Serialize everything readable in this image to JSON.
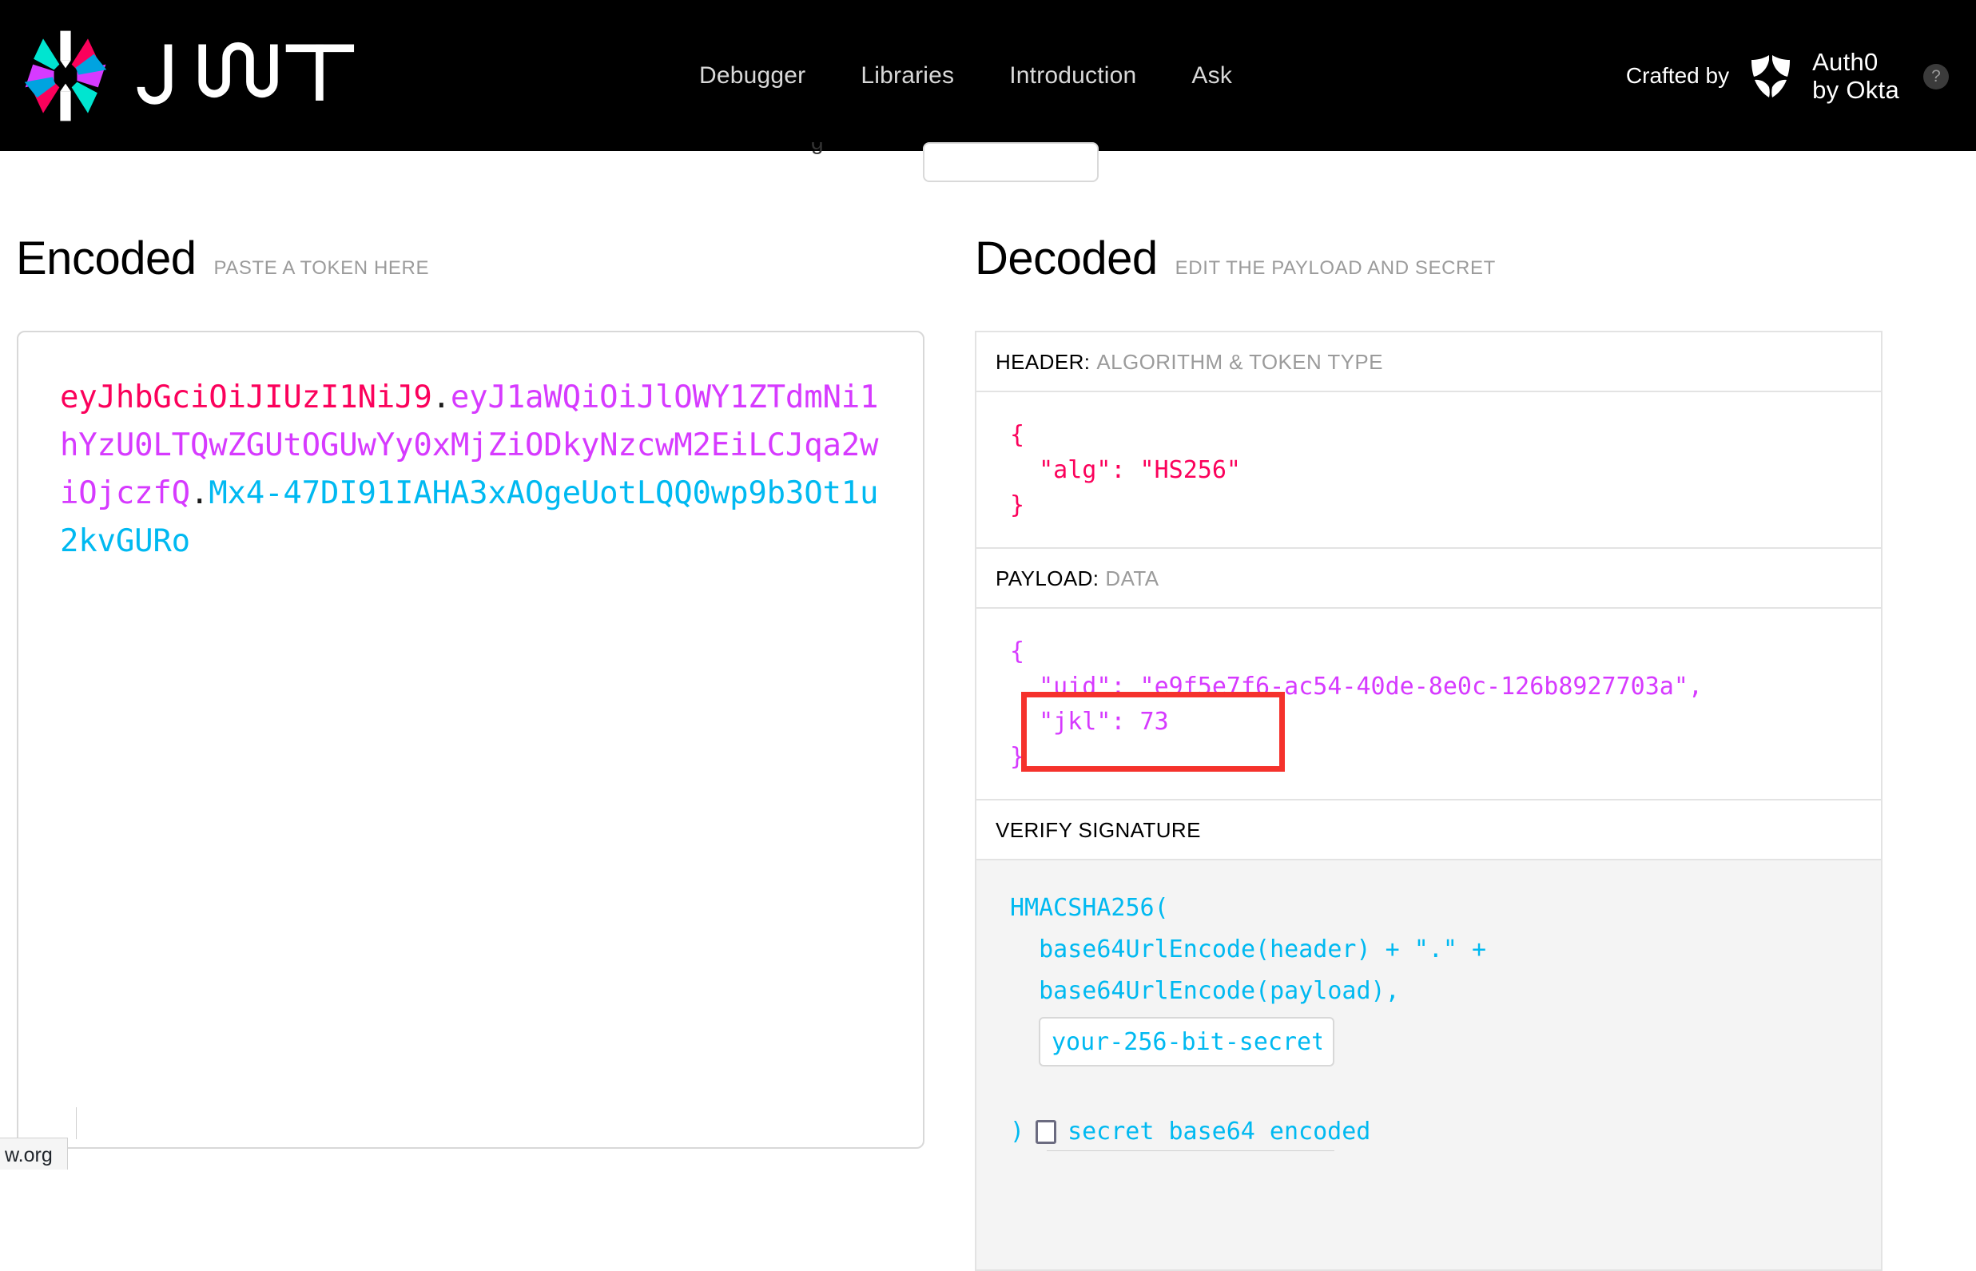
{
  "header": {
    "brand_name": "JWT",
    "logo_icon": "jwt-starburst-logo",
    "nav": [
      {
        "label": "Debugger"
      },
      {
        "label": "Libraries"
      },
      {
        "label": "Introduction"
      },
      {
        "label": "Ask"
      }
    ],
    "crafted_by_label": "Crafted by",
    "auth0_line1": "Auth0",
    "auth0_line2": "by Okta",
    "auth0_icon": "auth0-shield-icon",
    "help_badge": "?"
  },
  "peek": {
    "partial_text": "g",
    "note": "partially hidden algorithm selector behind sticky header"
  },
  "encoded": {
    "title": "Encoded",
    "subtitle": "PASTE A TOKEN HERE",
    "token": {
      "header_part": "eyJhbGciOiJIUzI1NiJ9",
      "payload_part": "eyJ1aWQiOiJlOWY1ZTdmNi1hYzU0LTQwZGUtOGUwYy0xMjZiODkyNzcwM2EiLCJqa2wiOjczfQ",
      "signature_part": "Mx4-47DI91IAHA3xAOgeUotLQQ0wp9b3Ot1u2kvGURo",
      "separator": "."
    },
    "colors": {
      "header": "#fb015b",
      "payload": "#d63aff",
      "signature": "#00b9f1"
    }
  },
  "decoded": {
    "title": "Decoded",
    "subtitle": "EDIT THE PAYLOAD AND SECRET",
    "header_section": {
      "label": "HEADER:",
      "sublabel": "ALGORITHM & TOKEN TYPE",
      "json": "{\n  \"alg\": \"HS256\"\n}"
    },
    "payload_section": {
      "label": "PAYLOAD:",
      "sublabel": "DATA",
      "json": "{\n  \"uid\": \"e9f5e7f6-ac54-40de-8e0c-126b8927703a\",\n  \"jkl\": 73\n}"
    },
    "signature_section": {
      "label": "VERIFY SIGNATURE",
      "line1": "HMACSHA256(",
      "line2": "  base64UrlEncode(header) + \".\" +",
      "line3": "  base64UrlEncode(payload),",
      "secret_value": "your-256-bit-secret",
      "secret_placeholder": "your-256-bit-secret",
      "close_paren": ")",
      "base64_label": "secret base64 encoded",
      "base64_checked": false
    }
  },
  "annotation": {
    "type": "red-rectangle-highlight",
    "color": "#f5322c",
    "targets": "\"uid\" and \"jkl\" payload claims"
  },
  "status_bar": {
    "link_text": "w.org"
  }
}
